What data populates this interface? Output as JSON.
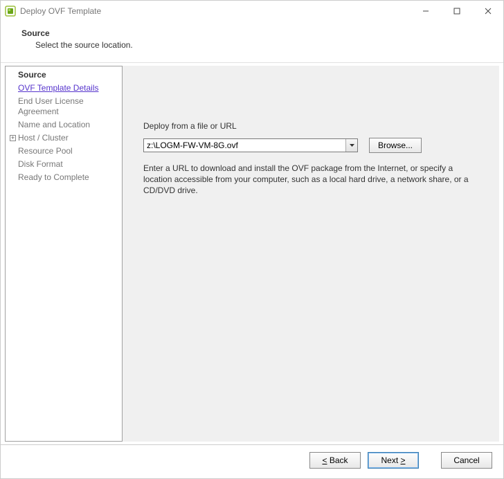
{
  "window": {
    "title": "Deploy OVF Template"
  },
  "header": {
    "title": "Source",
    "subtitle": "Select the source location."
  },
  "sidebar": {
    "steps": [
      {
        "label": "Source",
        "bold": true
      },
      {
        "label": "OVF Template Details",
        "link": true
      },
      {
        "label": "End User License Agreement"
      },
      {
        "label": "Name and Location"
      },
      {
        "label": "Host / Cluster",
        "expandable": true
      },
      {
        "label": "Resource Pool"
      },
      {
        "label": "Disk Format"
      },
      {
        "label": "Ready to Complete"
      }
    ]
  },
  "main": {
    "field_label": "Deploy from a file or URL",
    "input_value": "z:\\LOGM-FW-VM-8G.ovf",
    "browse_label": "Browse...",
    "help_text": "Enter a URL to download and install the OVF package from the Internet, or specify a location accessible from your computer, such as a local hard drive, a network share, or a CD/DVD drive."
  },
  "footer": {
    "back": "< Back",
    "next": "Next >",
    "cancel": "Cancel"
  }
}
